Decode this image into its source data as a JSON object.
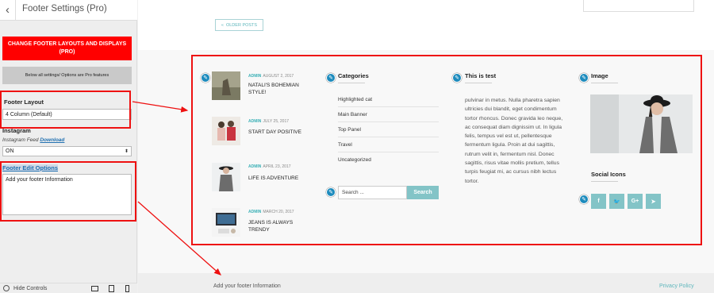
{
  "sidebar": {
    "title": "Footer Settings (Pro)",
    "pro_button": "CHANGE FOOTER LAYOUTS AND DISPLAYS (PRO)",
    "pro_note": "Below all settings/ Options are Pro features",
    "footer_layout": {
      "label": "Footer Layout",
      "value": "4 Column (Default)"
    },
    "instagram": {
      "label": "Instagram",
      "feed_text": "Instagram Feed",
      "download_link": "Download",
      "value": "ON"
    },
    "footer_edit": {
      "label": "Footer Edit Options",
      "value": "Add your footer Information"
    },
    "hide_controls": "Hide Controls"
  },
  "preview": {
    "older_posts": "OLDER POSTS",
    "posts": [
      {
        "author": "ADMIN",
        "date": "AUGUST 2, 2017",
        "title": "NATALI'S BOHEMIAN STYLE!"
      },
      {
        "author": "ADMIN",
        "date": "JULY 25, 2017",
        "title": "START DAY POSITIVE"
      },
      {
        "author": "ADMIN",
        "date": "APRIL 23, 2017",
        "title": "LIFE IS ADVENTURE"
      },
      {
        "author": "ADMIN",
        "date": "MARCH 20, 2017",
        "title": "JEANS IS ALWAYS TRENDY"
      }
    ],
    "categories": {
      "title": "Categories",
      "items": [
        "Highlighted cat",
        "Main Banner",
        "Top Panel",
        "Travel",
        "Uncategorized"
      ]
    },
    "search": {
      "placeholder": "Search ...",
      "button": "Search"
    },
    "text_widget": {
      "title": "This is test",
      "body": "pulvinar in metus. Nulla pharetra sapien ultricies dui blandit, eget condimentum tortor rhoncus. Donec gravida leo neque, ac consequat diam dignissim ut. In ligula felis, tempus vel est ut, pellentesque fermentum ligula. Proin at dui sagittis, rutrum velit in, fermentum nisl. Donec sagittis, risus vitae mollis pretium, tellus turpis feugiat mi, ac cursus nibh lectus tortor."
    },
    "image_widget": {
      "title": "Image"
    },
    "social": {
      "title": "Social Icons",
      "icons": [
        {
          "name": "facebook-icon",
          "glyph": "f"
        },
        {
          "name": "twitter-icon",
          "glyph": "🐦"
        },
        {
          "name": "google-plus-icon",
          "glyph": "G+"
        },
        {
          "name": "telegram-icon",
          "glyph": "➤"
        }
      ]
    },
    "footer_bottom": {
      "info": "Add your footer Information",
      "privacy": "Privacy Policy"
    }
  },
  "colors": {
    "accent": "#5db6bc",
    "button": "#83c4c7",
    "pencil": "#1d8bbd",
    "annotation": "#e11111",
    "pro_button": "#ff0000"
  }
}
